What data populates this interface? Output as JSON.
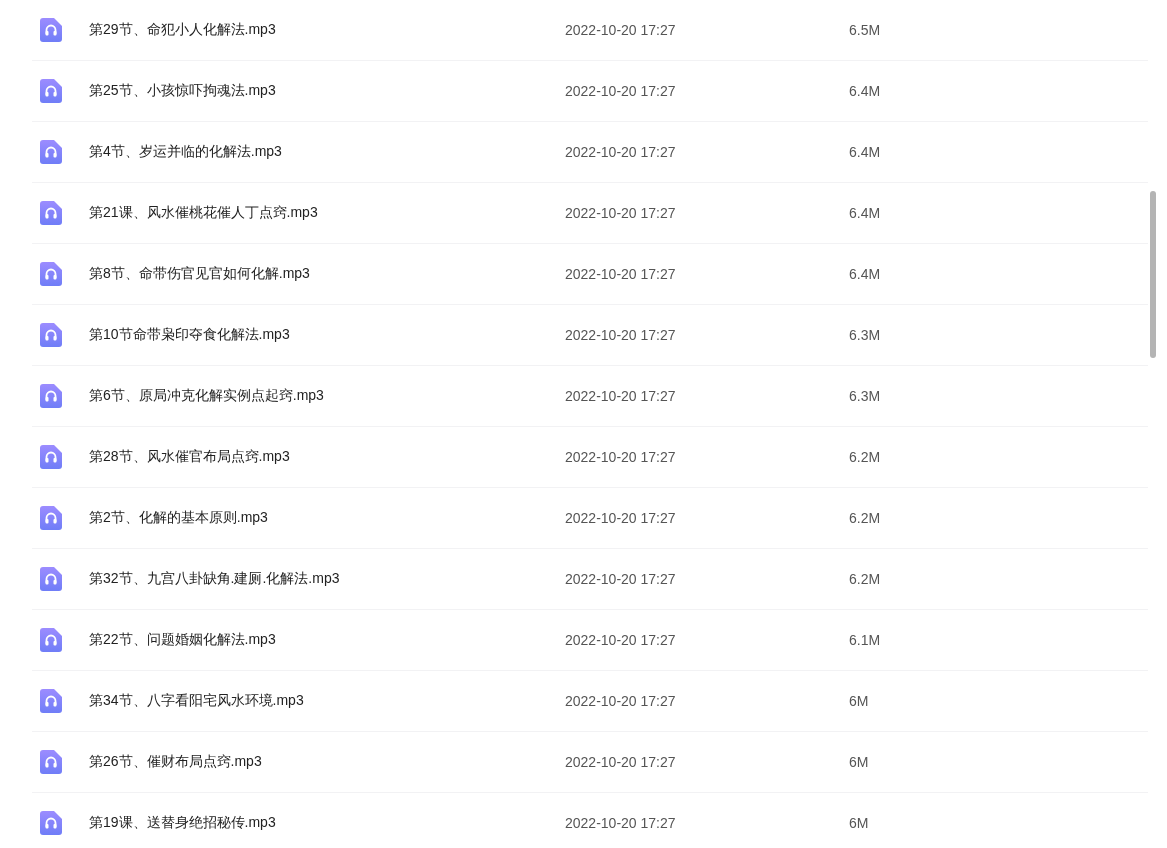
{
  "files": [
    {
      "name": "第29节、命犯小人化解法.mp3",
      "modified": "2022-10-20 17:27",
      "size": "6.5M"
    },
    {
      "name": "第25节、小孩惊吓拘魂法.mp3",
      "modified": "2022-10-20 17:27",
      "size": "6.4M"
    },
    {
      "name": "第4节、岁运并临的化解法.mp3",
      "modified": "2022-10-20 17:27",
      "size": "6.4M"
    },
    {
      "name": "第21课、风水催桃花催人丁点窍.mp3",
      "modified": "2022-10-20 17:27",
      "size": "6.4M"
    },
    {
      "name": "第8节、命带伤官见官如何化解.mp3",
      "modified": "2022-10-20 17:27",
      "size": "6.4M"
    },
    {
      "name": "第10节命带枭印夺食化解法.mp3",
      "modified": "2022-10-20 17:27",
      "size": "6.3M"
    },
    {
      "name": "第6节、原局冲克化解实例点起窍.mp3",
      "modified": "2022-10-20 17:27",
      "size": "6.3M"
    },
    {
      "name": "第28节、风水催官布局点窍.mp3",
      "modified": "2022-10-20 17:27",
      "size": "6.2M"
    },
    {
      "name": "第2节、化解的基本原则.mp3",
      "modified": "2022-10-20 17:27",
      "size": "6.2M"
    },
    {
      "name": "第32节、九宫八卦缺角.建厕.化解法.mp3",
      "modified": "2022-10-20 17:27",
      "size": "6.2M"
    },
    {
      "name": "第22节、问题婚姻化解法.mp3",
      "modified": "2022-10-20 17:27",
      "size": "6.1M"
    },
    {
      "name": "第34节、八字看阳宅风水环境.mp3",
      "modified": "2022-10-20 17:27",
      "size": "6M"
    },
    {
      "name": "第26节、催财布局点窍.mp3",
      "modified": "2022-10-20 17:27",
      "size": "6M"
    },
    {
      "name": "第19课、送替身绝招秘传.mp3",
      "modified": "2022-10-20 17:27",
      "size": "6M"
    }
  ]
}
